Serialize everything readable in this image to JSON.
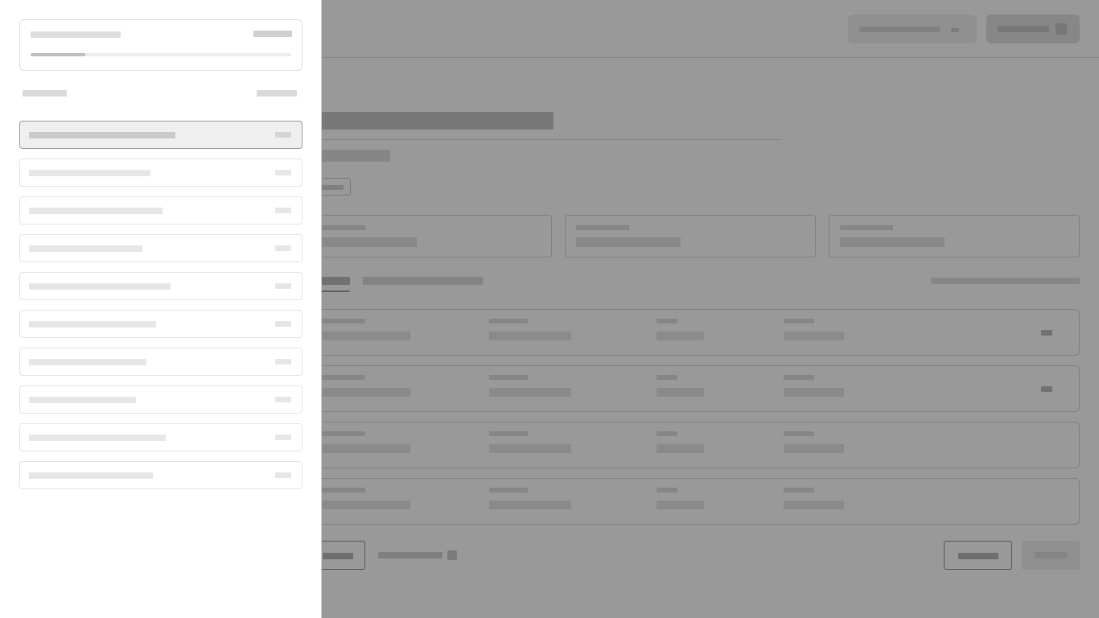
{
  "overlay": {
    "dimmed": true
  },
  "drawer": {
    "progress": {
      "fraction": 0.21
    },
    "items": [
      {
        "selected": true
      },
      {
        "selected": false
      },
      {
        "selected": false
      },
      {
        "selected": false
      },
      {
        "selected": false
      },
      {
        "selected": false
      },
      {
        "selected": false
      },
      {
        "selected": false
      },
      {
        "selected": false
      },
      {
        "selected": false
      }
    ]
  },
  "colors": {
    "placeholder": "#e6e6e6",
    "selected_background": "#efefef",
    "scrim": "#000000"
  }
}
